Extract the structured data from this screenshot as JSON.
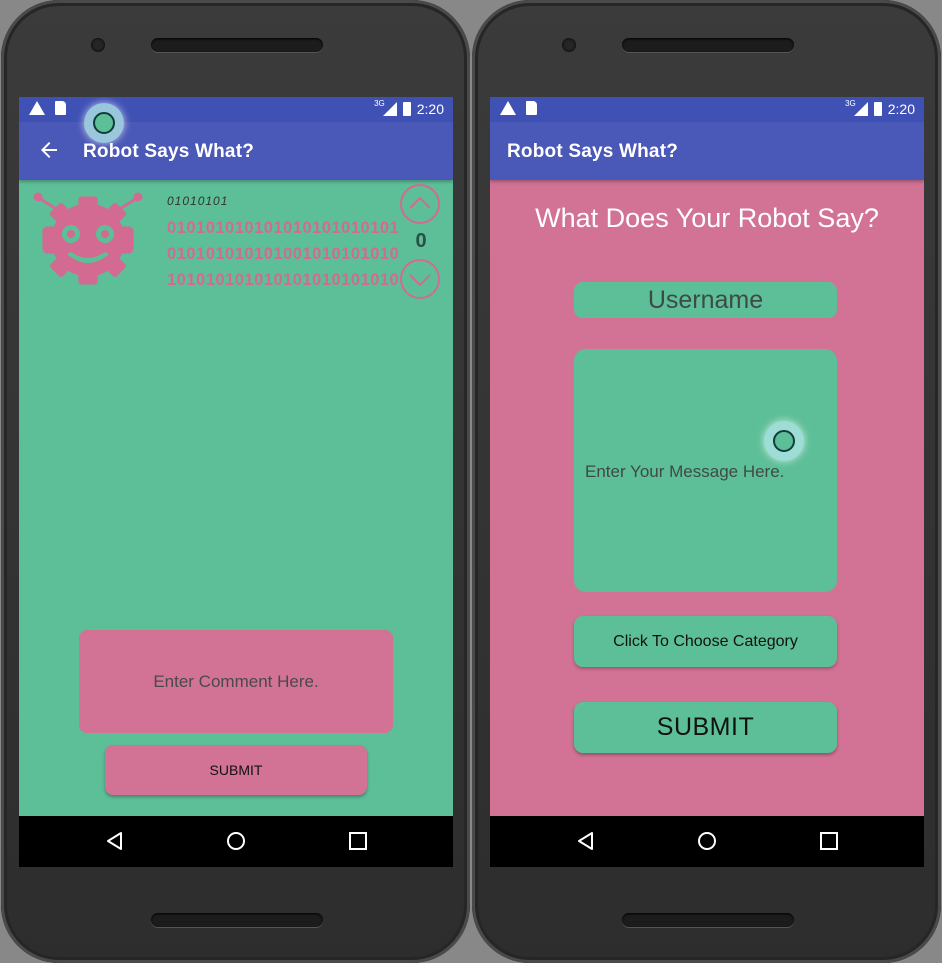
{
  "colors": {
    "accent_green": "#5dbf98",
    "accent_pink": "#d27294",
    "appbar_blue": "#4a58b7",
    "statusbar_blue": "#3f51b5"
  },
  "left_screen": {
    "status_bar": {
      "network": "3G",
      "time": "2:20"
    },
    "app_bar": {
      "back_icon": "arrow-left-icon",
      "title": "Robot Says What?"
    },
    "post": {
      "avatar_icon": "robot-icon",
      "binary_header": "01010101",
      "binary_lines": [
        "010101010101010101010101",
        "010101010101001010101010",
        "101010101010101010101010"
      ],
      "vote_count": "0"
    },
    "comment_placeholder": "Enter Comment Here.",
    "submit_label": "SUBMIT"
  },
  "right_screen": {
    "status_bar": {
      "network": "3G",
      "time": "2:20"
    },
    "app_bar": {
      "title": "Robot Says What?"
    },
    "heading": "What Does Your Robot Say?",
    "username_placeholder": "Username",
    "message_placeholder": "Enter Your Message Here.",
    "category_label": "Click To Choose Category",
    "submit_label": "SUBMIT"
  },
  "nav_icons": [
    "back-triangle-icon",
    "home-circle-icon",
    "recents-square-icon"
  ]
}
